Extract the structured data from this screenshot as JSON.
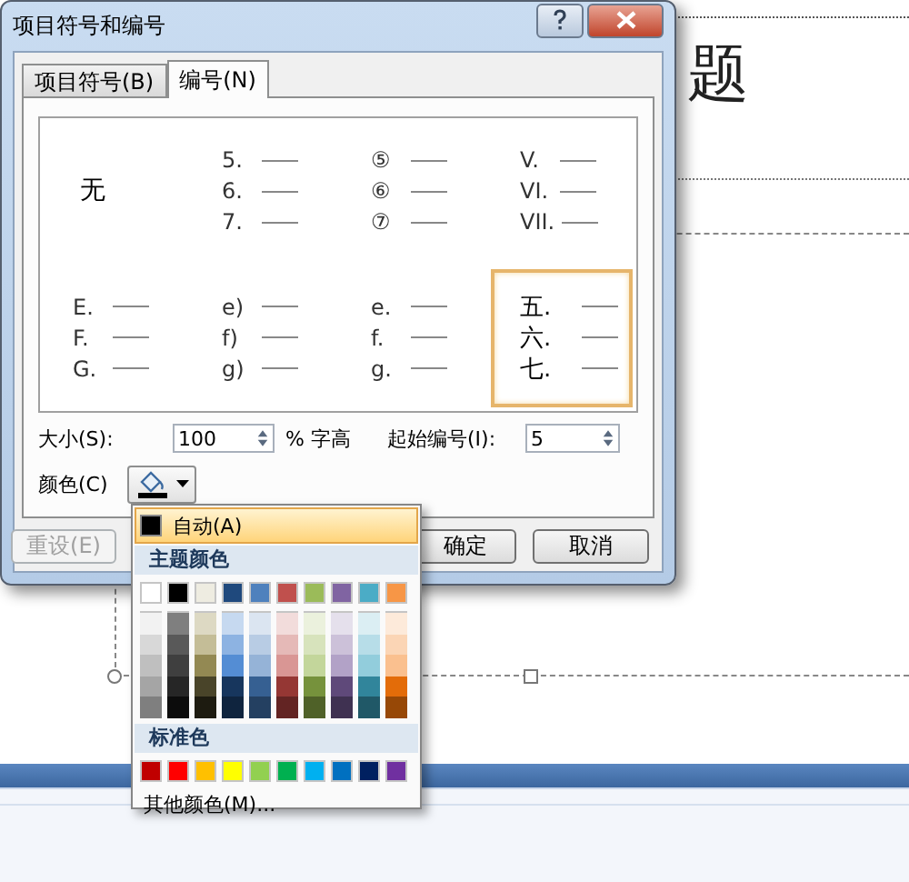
{
  "window": {
    "title": "项目符号和编号"
  },
  "tabs": [
    {
      "label": "项目符号(B)",
      "selected": false
    },
    {
      "label": "编号(N)",
      "selected": true
    }
  ],
  "numbering_styles": [
    {
      "kind": "none",
      "label": "无",
      "selected": false
    },
    {
      "kind": "list",
      "items": [
        "5.",
        "6.",
        "7."
      ],
      "selected": false
    },
    {
      "kind": "list",
      "items": [
        "⑤",
        "⑥",
        "⑦"
      ],
      "selected": false
    },
    {
      "kind": "list",
      "items": [
        "V.",
        "VI.",
        "VII."
      ],
      "selected": false
    },
    {
      "kind": "list",
      "items": [
        "E.",
        "F.",
        "G."
      ],
      "selected": false
    },
    {
      "kind": "list",
      "items": [
        "e)",
        "f)",
        "g)"
      ],
      "selected": false
    },
    {
      "kind": "list",
      "items": [
        "e.",
        "f.",
        "g."
      ],
      "selected": false
    },
    {
      "kind": "list",
      "items": [
        "五.",
        "六.",
        "七."
      ],
      "selected": true
    }
  ],
  "size": {
    "label": "大小(S):",
    "value": "100",
    "unit": "% 字高"
  },
  "start_at": {
    "label": "起始编号(I):",
    "value": "5"
  },
  "color": {
    "label": "颜色(C)"
  },
  "buttons": [
    {
      "label": "重设(E)",
      "disabled": true
    },
    {
      "label": "确定",
      "disabled": false
    },
    {
      "label": "取消",
      "disabled": false
    }
  ],
  "color_menu": {
    "automatic": {
      "label": "自动(A)",
      "color": "#000000",
      "selected": true
    },
    "theme_header": "主题颜色",
    "theme_colors": [
      {
        "color": "#ffffff",
        "shades": [
          {
            "color": "#f2f2f2"
          },
          {
            "color": "#d8d8d8"
          },
          {
            "color": "#bfbfbf"
          },
          {
            "color": "#a5a5a5"
          },
          {
            "color": "#7f7f7f"
          }
        ]
      },
      {
        "color": "#000000",
        "shades": [
          {
            "color": "#7f7f7f"
          },
          {
            "color": "#595959"
          },
          {
            "color": "#3f3f3f"
          },
          {
            "color": "#262626"
          },
          {
            "color": "#0c0c0c"
          }
        ]
      },
      {
        "color": "#eeece1",
        "shades": [
          {
            "color": "#ddd9c3"
          },
          {
            "color": "#c4bd97"
          },
          {
            "color": "#938953"
          },
          {
            "color": "#494429"
          },
          {
            "color": "#1d1b10"
          }
        ]
      },
      {
        "color": "#1f497d",
        "shades": [
          {
            "color": "#c6d9f0"
          },
          {
            "color": "#8db3e2"
          },
          {
            "color": "#548dd4"
          },
          {
            "color": "#17365d"
          },
          {
            "color": "#0f243e"
          }
        ]
      },
      {
        "color": "#4f81bd",
        "shades": [
          {
            "color": "#dbe5f1"
          },
          {
            "color": "#b8cce4"
          },
          {
            "color": "#95b3d7"
          },
          {
            "color": "#366092"
          },
          {
            "color": "#244061"
          }
        ]
      },
      {
        "color": "#c0504d",
        "shades": [
          {
            "color": "#f2dcdb"
          },
          {
            "color": "#e5b9b7"
          },
          {
            "color": "#d99694"
          },
          {
            "color": "#953734"
          },
          {
            "color": "#632423"
          }
        ]
      },
      {
        "color": "#9bbb59",
        "shades": [
          {
            "color": "#ebf1dd"
          },
          {
            "color": "#d7e3bc"
          },
          {
            "color": "#c3d69b"
          },
          {
            "color": "#76923c"
          },
          {
            "color": "#4f6128"
          }
        ]
      },
      {
        "color": "#8064a2",
        "shades": [
          {
            "color": "#e5e0ec"
          },
          {
            "color": "#ccc1d9"
          },
          {
            "color": "#b2a2c7"
          },
          {
            "color": "#5f497a"
          },
          {
            "color": "#3f3151"
          }
        ]
      },
      {
        "color": "#4bacc6",
        "shades": [
          {
            "color": "#dbeef3"
          },
          {
            "color": "#b7dde8"
          },
          {
            "color": "#92cddc"
          },
          {
            "color": "#31859b"
          },
          {
            "color": "#205867"
          }
        ]
      },
      {
        "color": "#f79646",
        "shades": [
          {
            "color": "#fdeada"
          },
          {
            "color": "#fbd5b5"
          },
          {
            "color": "#fac08f"
          },
          {
            "color": "#e36c09"
          },
          {
            "color": "#974806"
          }
        ]
      }
    ],
    "standard_header": "标准色",
    "standard_colors": [
      {
        "color": "#c00000"
      },
      {
        "color": "#ff0000"
      },
      {
        "color": "#ffc000"
      },
      {
        "color": "#ffff00"
      },
      {
        "color": "#92d050"
      },
      {
        "color": "#00b050"
      },
      {
        "color": "#00b0f0"
      },
      {
        "color": "#0070c0"
      },
      {
        "color": "#002060"
      },
      {
        "color": "#7030a0"
      }
    ],
    "more": "其他颜色(M)..."
  },
  "slide": {
    "title": "题"
  }
}
